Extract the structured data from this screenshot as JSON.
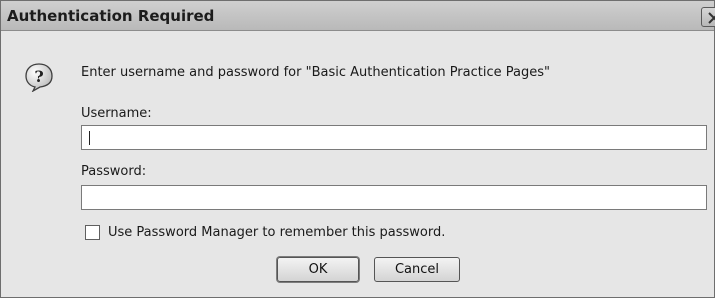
{
  "window": {
    "title": "Authentication Required"
  },
  "dialog": {
    "message": "Enter username and password for \"Basic Authentication Practice Pages\"",
    "username_label": "Username:",
    "username_value": "",
    "password_label": "Password:",
    "password_value": "",
    "remember_label": "Use Password Manager to remember this password.",
    "remember_checked": false,
    "ok_label": "OK",
    "cancel_label": "Cancel"
  },
  "icons": {
    "prompt": "question-icon",
    "close": "close-icon"
  }
}
